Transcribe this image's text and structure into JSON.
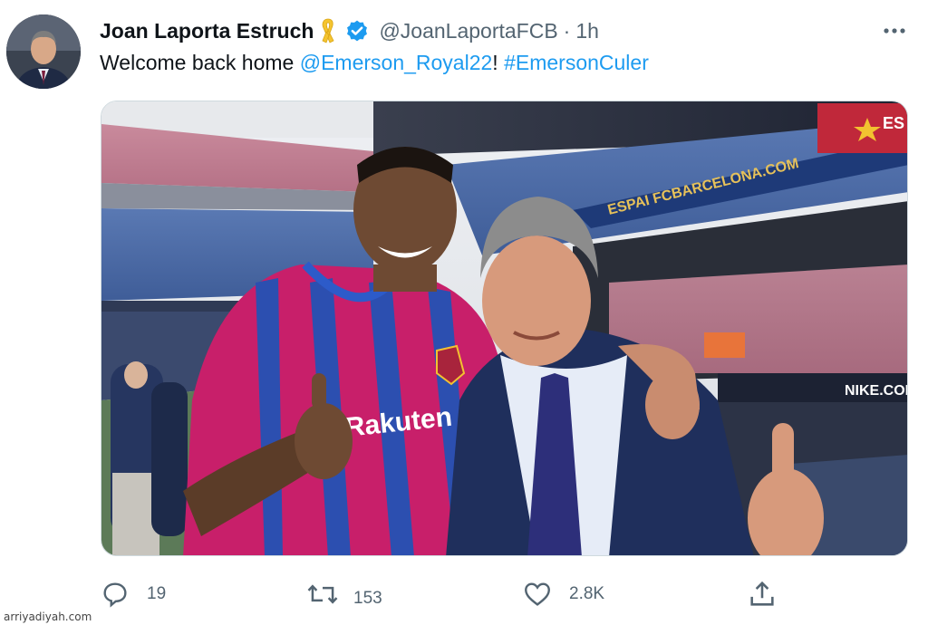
{
  "tweet": {
    "author_name": "Joan Laporta Estruch",
    "handle": "@JoanLaportaFCB",
    "separator": "·",
    "time": "1h",
    "text_plain": "Welcome back home ",
    "mention": "@Emerson_Royal22",
    "text_punct": "! ",
    "hashtag": "#EmersonCuler",
    "author_icons": [
      "yellow-ribbon-icon",
      "verified-badge-icon"
    ]
  },
  "photo": {
    "shirt_sponsor": "Rakuten",
    "stadium_sign": "ESPAI FCBARCELONA.COM",
    "ad_board": "NIKE.COM"
  },
  "actions": {
    "reply_count": "19",
    "retweet_count": "153",
    "like_count": "2.8K"
  },
  "watermark": "arriyadiyah.com",
  "colors": {
    "accent": "#1d9bf0",
    "text": "#0f1419",
    "secondary": "#536471",
    "ribbon": "#f4c430"
  }
}
